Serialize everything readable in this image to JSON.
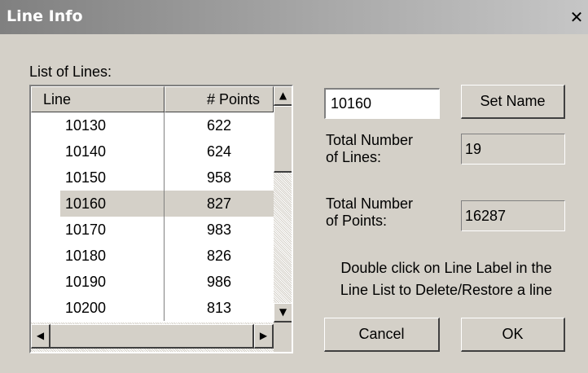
{
  "window": {
    "title": "Line Info",
    "close_glyph": "✕",
    "close_icon": "close-icon"
  },
  "list": {
    "label": "List of Lines:",
    "columns": [
      "Line",
      "# Points"
    ],
    "rows": [
      {
        "line": "10130",
        "points": "622"
      },
      {
        "line": "10140",
        "points": "624"
      },
      {
        "line": "10150",
        "points": "958"
      },
      {
        "line": "10160",
        "points": "827",
        "selected": true
      },
      {
        "line": "10170",
        "points": "983"
      },
      {
        "line": "10180",
        "points": "826"
      },
      {
        "line": "10190",
        "points": "986"
      },
      {
        "line": "10200",
        "points": "813"
      }
    ],
    "scroll_up_glyph": "▲",
    "scroll_down_glyph": "▼",
    "scroll_left_glyph": "◀",
    "scroll_right_glyph": "▶"
  },
  "name_input": {
    "value": "10160"
  },
  "buttons": {
    "set_name": "Set Name",
    "cancel": "Cancel",
    "ok": "OK"
  },
  "total_lines": {
    "label": "Total Number\nof Lines:",
    "value": "19"
  },
  "total_points": {
    "label": "Total Number\nof Points:",
    "value": "16287"
  },
  "hint": "Double click on Line Label in the\nLine List to Delete/Restore a line",
  "colors": {
    "face": "#d4d0c8",
    "title_gradient_start": "#808080",
    "title_gradient_end": "#c6c6c6",
    "selection": "#d4d0c8"
  }
}
